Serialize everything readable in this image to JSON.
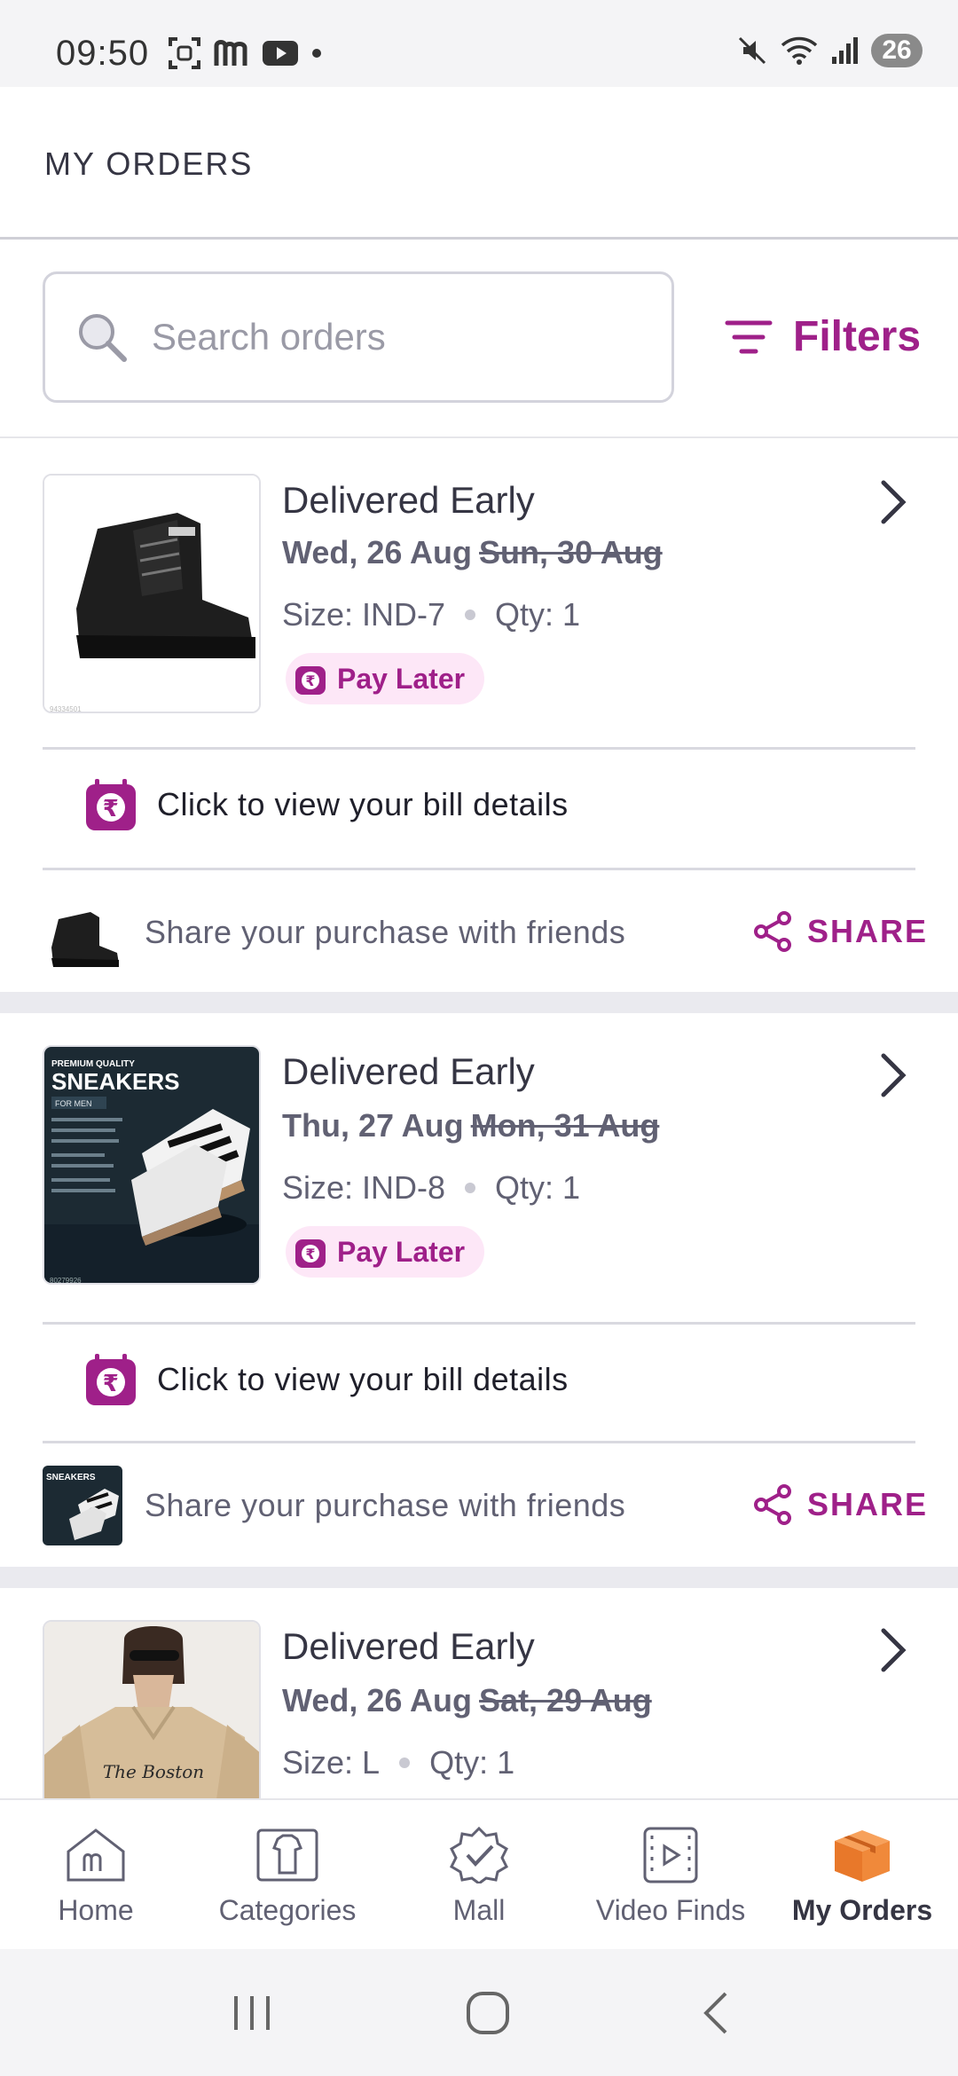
{
  "status_bar": {
    "time": "09:50",
    "battery": "26"
  },
  "header": {
    "title": "MY ORDERS"
  },
  "search": {
    "placeholder": "Search orders",
    "filters_label": "Filters"
  },
  "orders": [
    {
      "status": "Delivered Early",
      "date": "Wed, 26 Aug",
      "old_date": "Sun, 30 Aug",
      "size": "Size: IND-7",
      "qty": "Qty: 1",
      "pay_label": "Pay Later",
      "bill_label": "Click to view your bill details",
      "share_text": "Share your purchase with friends",
      "share_label": "SHARE",
      "thumb_code": "94334501"
    },
    {
      "status": "Delivered Early",
      "date": "Thu, 27 Aug",
      "old_date": "Mon, 31 Aug",
      "size": "Size: IND-8",
      "qty": "Qty: 1",
      "pay_label": "Pay Later",
      "bill_label": "Click to view your bill details",
      "share_text": "Share your purchase with friends",
      "share_label": "SHARE",
      "thumb_title": "SNEAKERS",
      "thumb_sub": "PREMIUM QUALITY",
      "thumb_for": "FOR MEN",
      "thumb_code": "80279926"
    },
    {
      "status": "Delivered Early",
      "date": "Wed, 26 Aug",
      "old_date": "Sat, 29 Aug",
      "size": "Size: L",
      "qty": "Qty: 1",
      "thumb_print": "The Boston"
    }
  ],
  "bottom_nav": [
    {
      "label": "Home",
      "icon": "home-icon"
    },
    {
      "label": "Categories",
      "icon": "categories-icon"
    },
    {
      "label": "Mall",
      "icon": "mall-icon"
    },
    {
      "label": "Video Finds",
      "icon": "video-icon"
    },
    {
      "label": "My Orders",
      "icon": "orders-box-icon",
      "active": true
    }
  ],
  "colors": {
    "accent": "#9f2089",
    "pay_bg": "#fde7f7",
    "orders_box": "#f0893a"
  }
}
